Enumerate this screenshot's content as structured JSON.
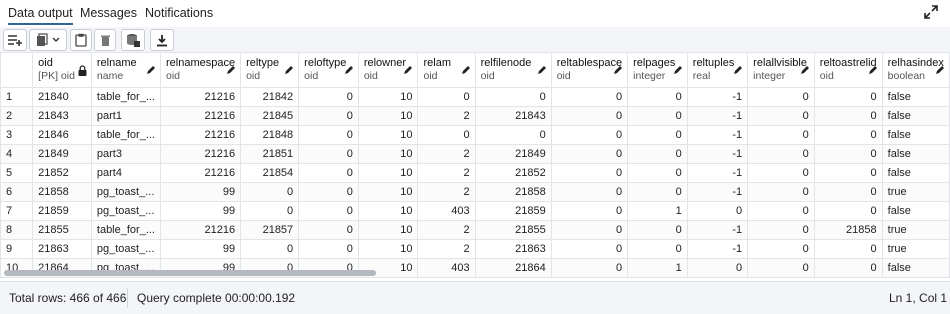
{
  "tabs": [
    {
      "label": "Data output",
      "active": true
    },
    {
      "label": "Messages",
      "active": false
    },
    {
      "label": "Notifications",
      "active": false
    }
  ],
  "toolbar": {
    "icons": [
      "add-row-icon",
      "copy-icon",
      "chevron-down-icon",
      "paste-icon",
      "delete-icon",
      "save-data-icon",
      "download-icon"
    ]
  },
  "grid": {
    "columns": [
      {
        "name": "oid",
        "type": "[PK] oid",
        "lock": true
      },
      {
        "name": "relname",
        "type": "name"
      },
      {
        "name": "relnamespace",
        "type": "oid"
      },
      {
        "name": "reltype",
        "type": "oid"
      },
      {
        "name": "reloftype",
        "type": "oid"
      },
      {
        "name": "relowner",
        "type": "oid"
      },
      {
        "name": "relam",
        "type": "oid"
      },
      {
        "name": "relfilenode",
        "type": "oid"
      },
      {
        "name": "reltablespace",
        "type": "oid"
      },
      {
        "name": "relpages",
        "type": "integer"
      },
      {
        "name": "reltuples",
        "type": "real"
      },
      {
        "name": "relallvisible",
        "type": "integer"
      },
      {
        "name": "reltoastrelid",
        "type": "oid"
      },
      {
        "name": "relhasindex",
        "type": "boolean"
      }
    ],
    "rows": [
      [
        "1",
        "21840",
        "table_for_...",
        "21216",
        "21842",
        "0",
        "10",
        "0",
        "0",
        "0",
        "0",
        "-1",
        "0",
        "0",
        "false"
      ],
      [
        "2",
        "21843",
        "part1",
        "21216",
        "21845",
        "0",
        "10",
        "2",
        "21843",
        "0",
        "0",
        "-1",
        "0",
        "0",
        "false"
      ],
      [
        "3",
        "21846",
        "table_for_...",
        "21216",
        "21848",
        "0",
        "10",
        "0",
        "0",
        "0",
        "0",
        "-1",
        "0",
        "0",
        "false"
      ],
      [
        "4",
        "21849",
        "part3",
        "21216",
        "21851",
        "0",
        "10",
        "2",
        "21849",
        "0",
        "0",
        "-1",
        "0",
        "0",
        "false"
      ],
      [
        "5",
        "21852",
        "part4",
        "21216",
        "21854",
        "0",
        "10",
        "2",
        "21852",
        "0",
        "0",
        "-1",
        "0",
        "0",
        "false"
      ],
      [
        "6",
        "21858",
        "pg_toast_...",
        "99",
        "0",
        "0",
        "10",
        "2",
        "21858",
        "0",
        "0",
        "-1",
        "0",
        "0",
        "true"
      ],
      [
        "7",
        "21859",
        "pg_toast_...",
        "99",
        "0",
        "0",
        "10",
        "403",
        "21859",
        "0",
        "1",
        "0",
        "0",
        "0",
        "false"
      ],
      [
        "8",
        "21855",
        "table_for_...",
        "21216",
        "21857",
        "0",
        "10",
        "2",
        "21855",
        "0",
        "0",
        "-1",
        "0",
        "21858",
        "true"
      ],
      [
        "9",
        "21863",
        "pg_toast_...",
        "99",
        "0",
        "0",
        "10",
        "2",
        "21863",
        "0",
        "0",
        "-1",
        "0",
        "0",
        "true"
      ],
      [
        "10",
        "21864",
        "pg_toast_...",
        "99",
        "0",
        "0",
        "10",
        "403",
        "21864",
        "0",
        "1",
        "0",
        "0",
        "0",
        "false"
      ]
    ]
  },
  "status": {
    "total_rows": "Total rows: 466 of 466",
    "query": "Query complete 00:00:00.192",
    "cursor": "Ln 1, Col 1"
  }
}
